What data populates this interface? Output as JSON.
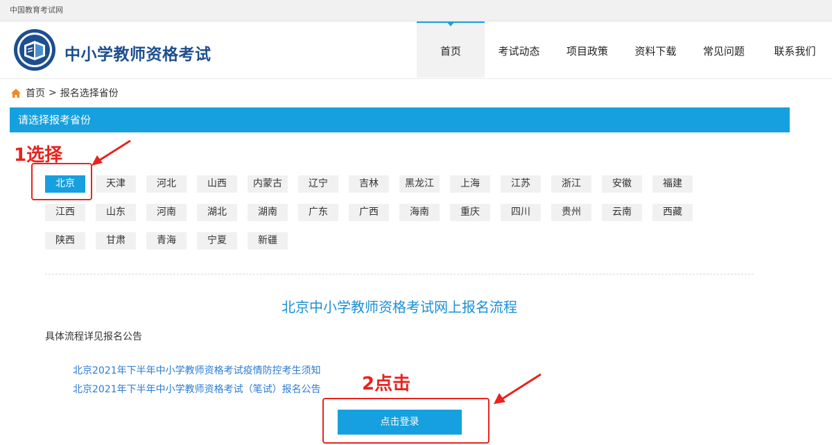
{
  "topbar": {
    "site_name": "中国教育考试网"
  },
  "header": {
    "logo_title": "中小学教师资格考试",
    "nav": [
      {
        "label": "首页",
        "active": true
      },
      {
        "label": "考试动态",
        "active": false
      },
      {
        "label": "项目政策",
        "active": false
      },
      {
        "label": "资料下载",
        "active": false
      },
      {
        "label": "常见问题",
        "active": false
      },
      {
        "label": "联系我们",
        "active": false
      }
    ]
  },
  "breadcrumb": {
    "home": "首页",
    "separator": ">",
    "current": "报名选择省份"
  },
  "section_title": "请选择报考省份",
  "provinces": [
    "北京",
    "天津",
    "河北",
    "山西",
    "内蒙古",
    "辽宁",
    "吉林",
    "黑龙江",
    "上海",
    "江苏",
    "浙江",
    "安徽",
    "福建",
    "江西",
    "山东",
    "河南",
    "湖北",
    "湖南",
    "广东",
    "广西",
    "海南",
    "重庆",
    "四川",
    "贵州",
    "云南",
    "西藏",
    "陕西",
    "甘肃",
    "青海",
    "宁夏",
    "新疆"
  ],
  "selected_province": "北京",
  "flow": {
    "title": "北京中小学教师资格考试网上报名流程",
    "detail": "具体流程详见报名公告",
    "links": [
      "北京2021年下半年中小学教师资格考试疫情防控考生须知",
      "北京2021年下半年中小学教师资格考试（笔试）报名公告"
    ],
    "login_button": "点击登录"
  },
  "annotations": {
    "step1": "1选择",
    "step2": "2点击",
    "color": "#e8231d"
  },
  "colors": {
    "accent": "#16a0df",
    "link": "#2c7bd3",
    "title_blue": "#1d4e8f"
  }
}
